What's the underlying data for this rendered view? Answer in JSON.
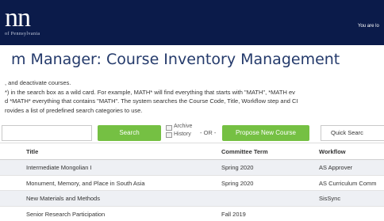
{
  "header": {
    "logo_text": "nn",
    "logo_sub": "of Pennsylvania",
    "logged_in_text": "You are lo"
  },
  "page_title": "m Manager: Course Inventory Management",
  "description_lines": [
    ", and deactivate courses.",
    "*) in the search box as a wild card. For example, MATH* will find everything that starts with \"MATH\", *MATH ev",
    "d *MATH* everything that contains \"MATH\". The system searches the Course Code, Title, Workflow step and CI",
    "rovides a list of predefined search categories to use."
  ],
  "search": {
    "input_value": "",
    "search_label": "Search",
    "archive_label": "Archive",
    "history_label": "History",
    "or_label": "- OR -",
    "propose_label": "Propose New Course",
    "quick_search_label": "Quick Searc"
  },
  "table": {
    "headers": [
      "Title",
      "Committee Term",
      "Workflow"
    ],
    "rows": [
      {
        "title": "Intermediate Mongolian I",
        "term": "Spring 2020",
        "workflow": "AS Approver"
      },
      {
        "title": "Monument, Memory, and Place in South Asia",
        "term": "Spring 2020",
        "workflow": "AS Curriculum Comm"
      },
      {
        "title": "New Materials and Methods",
        "term": "",
        "workflow": "SisSync"
      },
      {
        "title": "Senior Research Participation",
        "term": "Fall 2019",
        "workflow": ""
      }
    ]
  },
  "colors": {
    "header_bg": "#0b1b4a",
    "accent_green": "#75c043",
    "title_blue": "#243a6b"
  }
}
